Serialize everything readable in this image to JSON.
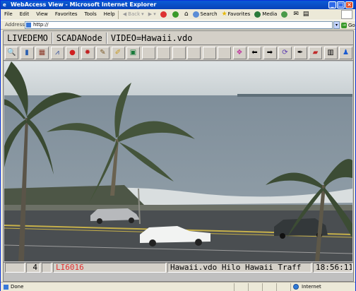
{
  "window": {
    "title": "WebAccess View - Microsoft Internet Explorer"
  },
  "menu": {
    "items": [
      "File",
      "Edit",
      "View",
      "Favorites",
      "Tools",
      "Help"
    ],
    "back_label": "Back",
    "search_label": "Search",
    "favorites_label": "Favorites",
    "media_label": "Media"
  },
  "address": {
    "label": "Address",
    "value": "http://",
    "go_label": "Go"
  },
  "webaccess": {
    "project": "LIVEDEMO",
    "node": "SCADANode",
    "video": "VIDEO=Hawaii.vdo"
  },
  "toolbar_icons": [
    "magnifier-icon",
    "phone-icon",
    "chart-icon",
    "trend-icon",
    "red-ball-icon",
    "alarm-icon",
    "tag-icon",
    "pencil-icon",
    "monitor-icon",
    "",
    "",
    "",
    "",
    "",
    "",
    "color-cubes-icon",
    "back-arrow-icon",
    "forward-arrow-icon",
    "cycle-icon",
    "pen-icon",
    "eraser-icon",
    "film-icon",
    "person-icon"
  ],
  "status": {
    "blank1": "",
    "count": "4",
    "alarm_tag": "LI6016",
    "message": "Hawaii.vdo Hilo Hawaii Traff",
    "time": "18:56:11",
    "alarm_color": "#e03030"
  },
  "browser_status": {
    "left": "Done",
    "zone": "Internet"
  }
}
